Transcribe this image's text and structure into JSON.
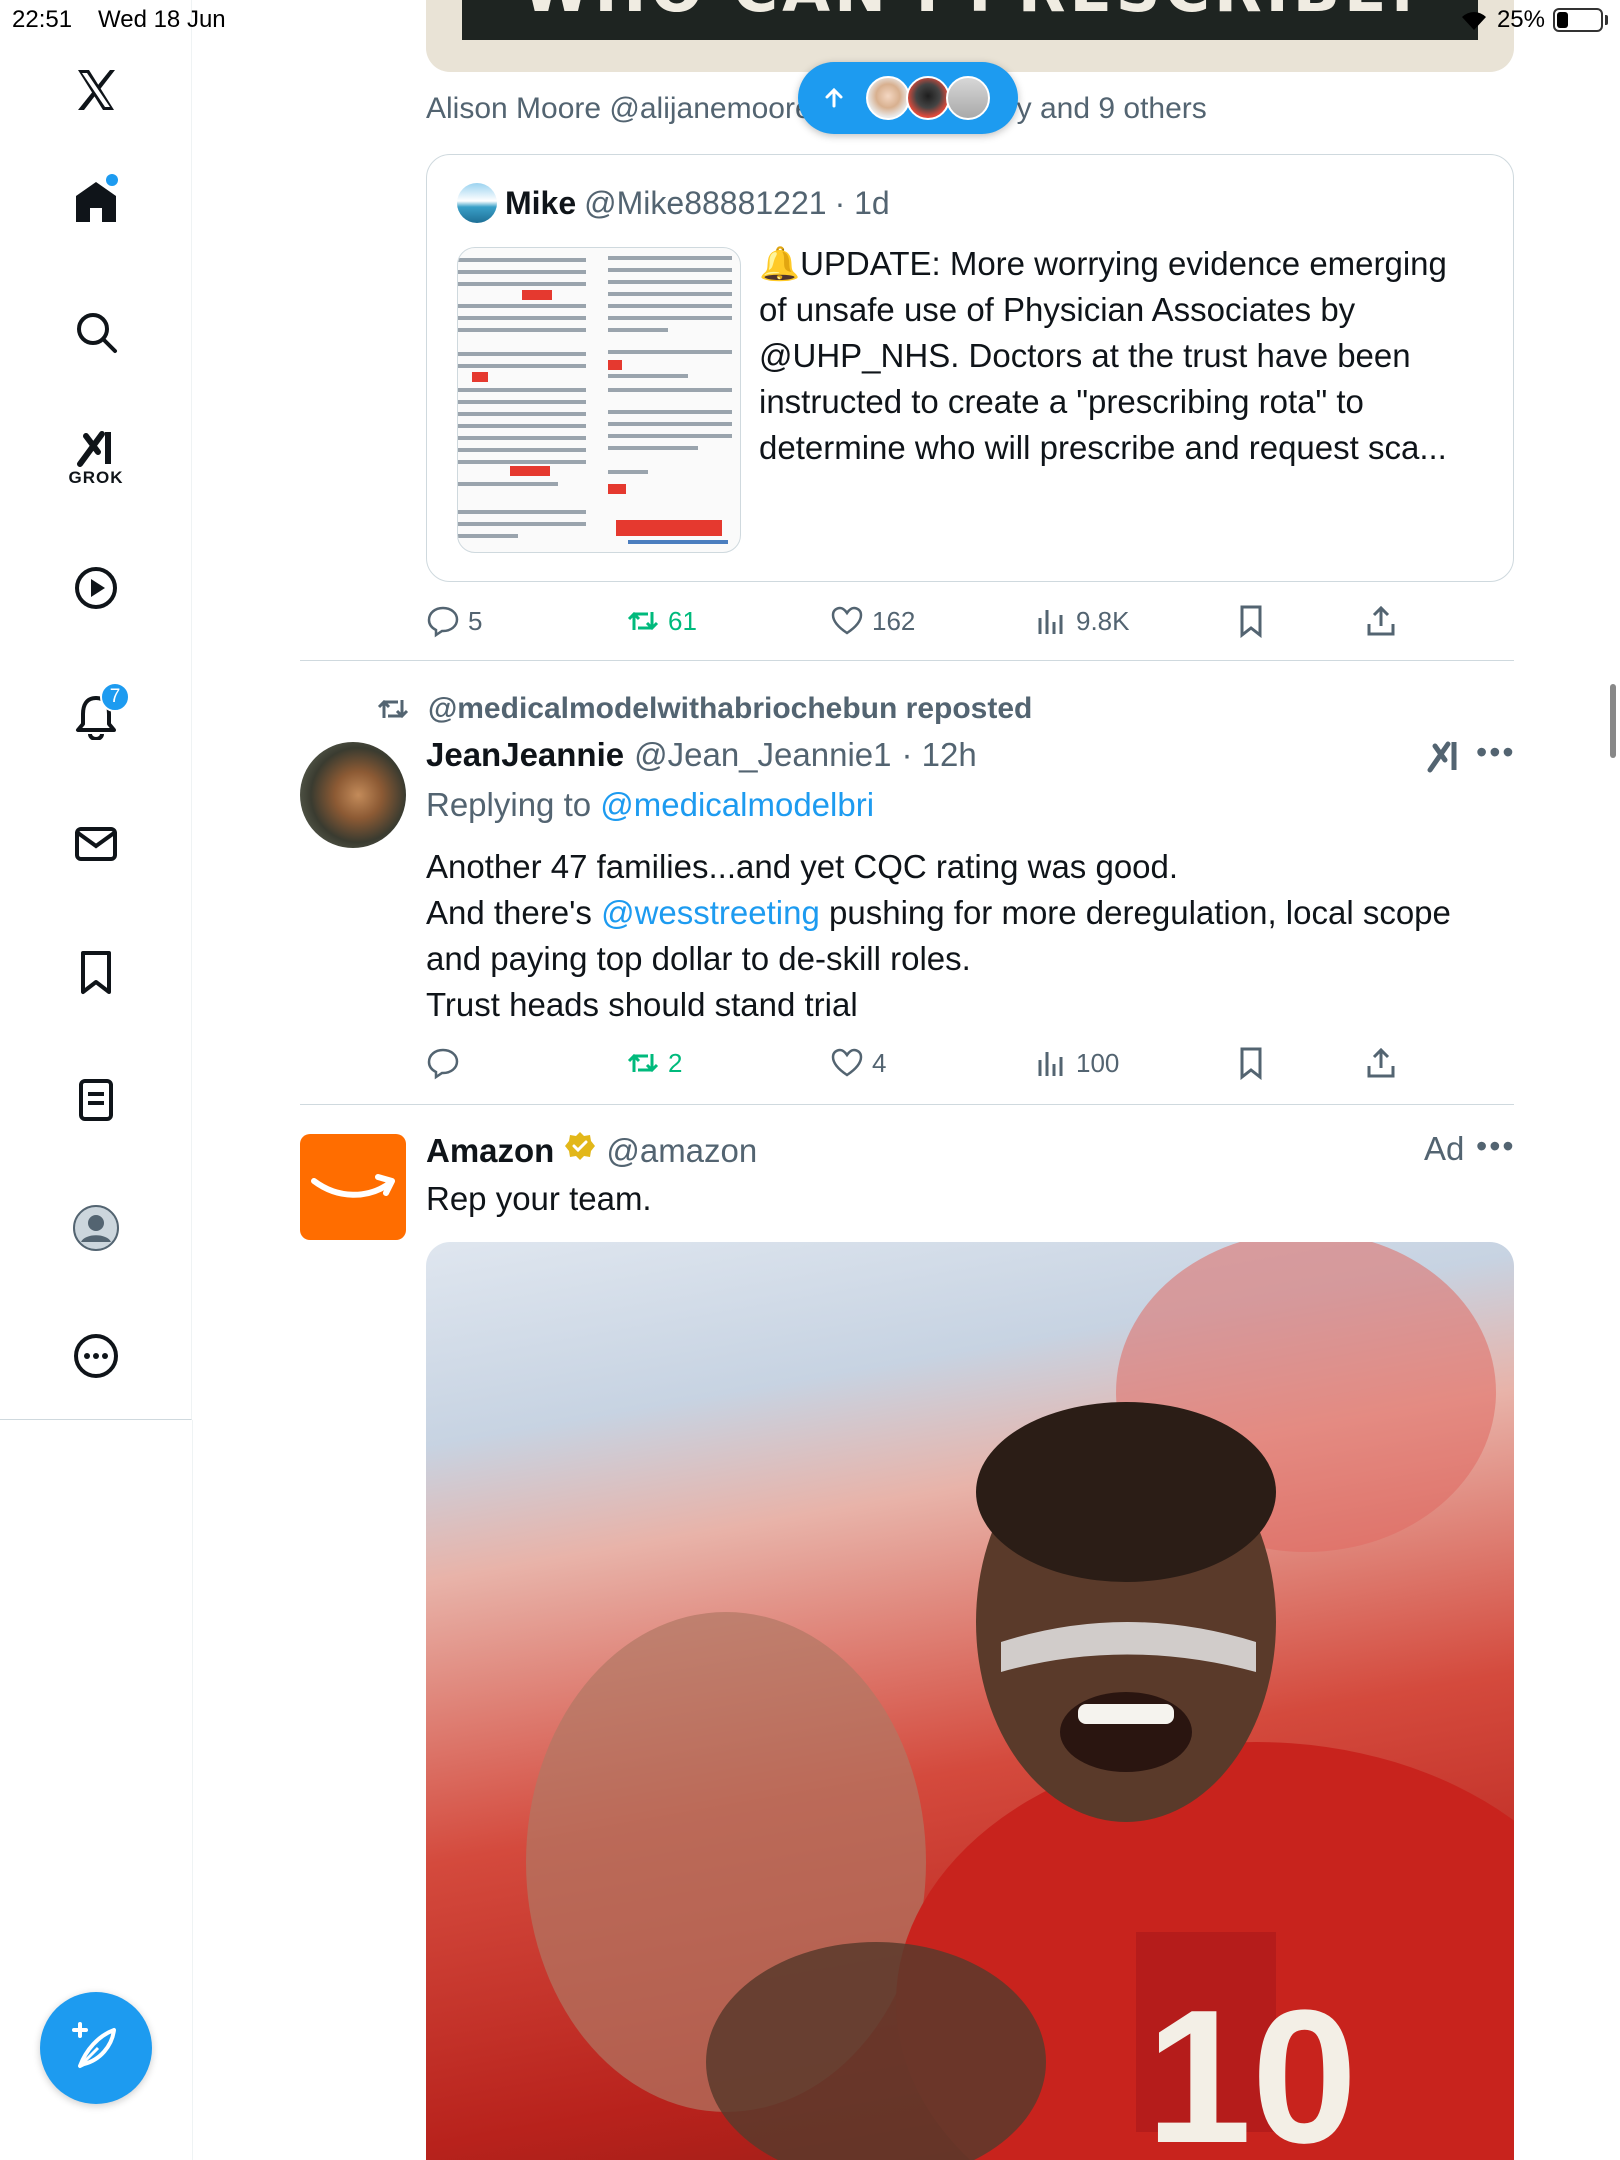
{
  "status_bar": {
    "time": "22:51",
    "date": "Wed 18 Jun",
    "battery_pct": "25%",
    "battery_level": 0.25
  },
  "sidebar": {
    "notifications_badge": "7",
    "grok_label": "GROK",
    "items": [
      {
        "name": "x-logo-icon"
      },
      {
        "name": "home-icon"
      },
      {
        "name": "search-icon"
      },
      {
        "name": "grok-icon"
      },
      {
        "name": "video-icon"
      },
      {
        "name": "notifications-icon"
      },
      {
        "name": "messages-icon"
      },
      {
        "name": "bookmarks-icon"
      },
      {
        "name": "lists-icon"
      },
      {
        "name": "profile-icon"
      },
      {
        "name": "more-icon"
      }
    ]
  },
  "top_post": {
    "banner_text": "WHO CAN I PRESCRIBE.",
    "liked_by_prefix": "Alison Moore @alijanemoore",
    "liked_by_suffix": "y and 9 others",
    "quote": {
      "name": "Mike",
      "handle": "@Mike88881221",
      "time": "· 1d",
      "text": "🔔UPDATE: More worrying evidence emerging of unsafe use of Physician Associates by @UHP_NHS. Doctors at the trust have been instructed to create a \"prescribing rota\" to determine who will prescribe and request sca..."
    },
    "actions": {
      "replies": "5",
      "reposts": "61",
      "likes": "162",
      "views": "9.8K"
    }
  },
  "repost_post": {
    "reposted_by": "@medicalmodelwithabriochebun reposted",
    "name": "JeanJeannie",
    "handle": "@Jean_Jeannie1",
    "time": "· 12h",
    "replying_prefix": "Replying to ",
    "replying_to": "@medicalmodelbri",
    "line1": "Another 47 families...and yet CQC rating was good.",
    "line2_prefix": "And there's ",
    "line2_mention": "@wesstreeting",
    "line2_suffix": " pushing for more deregulation, local scope",
    "line3": "and paying top dollar to de-skill roles.",
    "line4": "Trust heads should stand trial",
    "actions": {
      "replies": "",
      "reposts": "2",
      "likes": "4",
      "views": "100"
    }
  },
  "ad_post": {
    "name": "Amazon",
    "handle": "@amazon",
    "ad_label": "Ad",
    "text": "Rep your team.",
    "image_jersey_number": "10"
  },
  "colors": {
    "accent": "#1d9bf0",
    "repost_green": "#00ba7c",
    "amazon_orange": "#ff6d00",
    "secondary_text": "#536471"
  }
}
